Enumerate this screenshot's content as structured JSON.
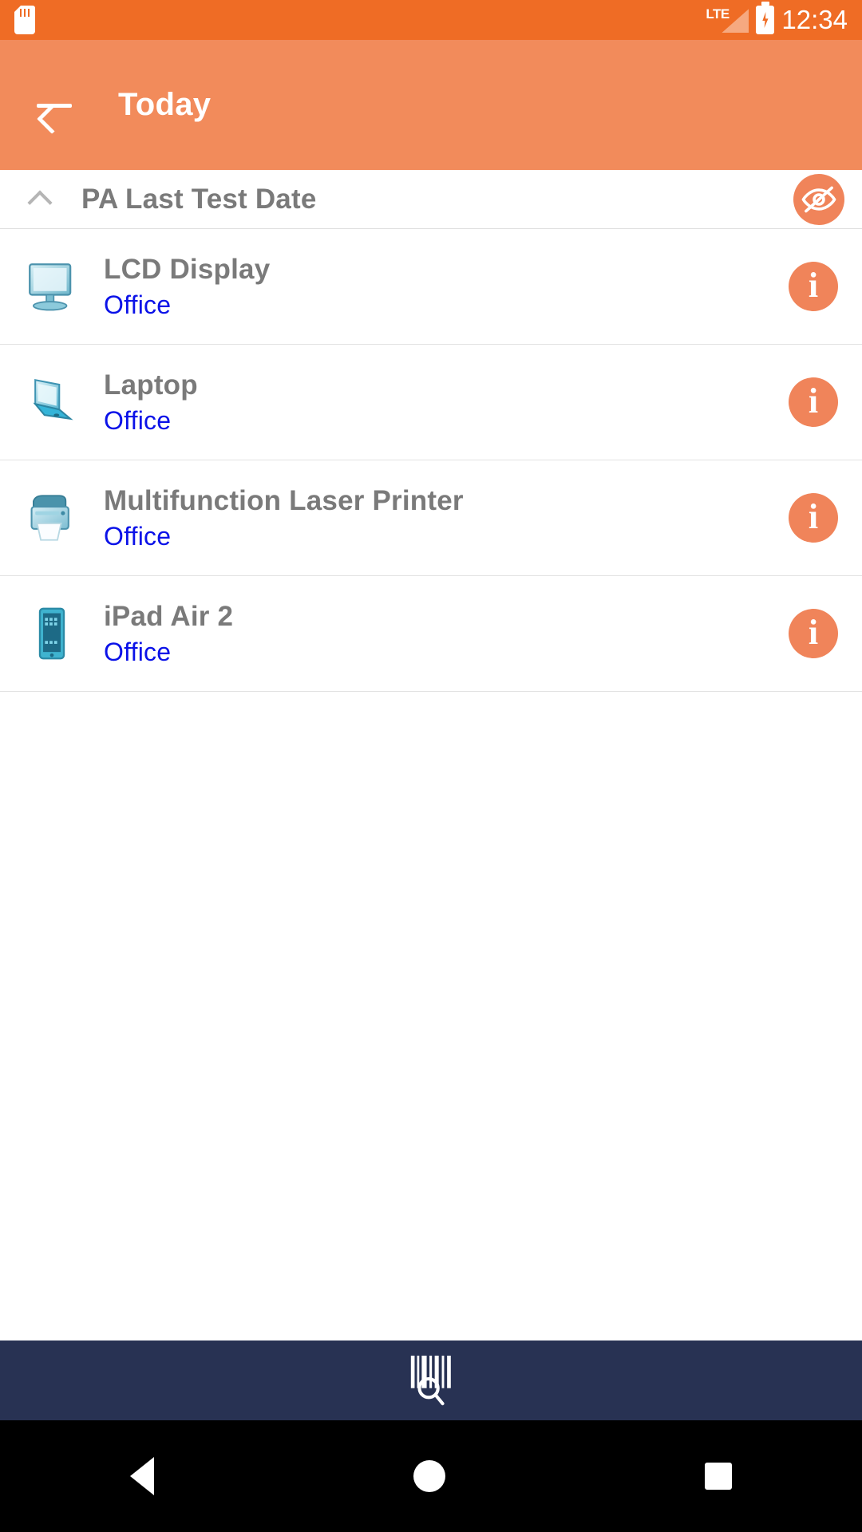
{
  "status_bar": {
    "sd_icon": "sd-card-icon",
    "network_label": "LTE",
    "battery_icon": "battery-charging-icon",
    "time": "12:34",
    "background_color": "#EF6C25"
  },
  "toolbar": {
    "back_icon": "arrow-left-icon",
    "title": "Today",
    "background_color": "#F28B5B"
  },
  "section": {
    "collapse_icon": "chevron-up-icon",
    "title": "PA Last Test Date",
    "visibility_icon": "eye-off-icon",
    "accent_color": "#F0845A",
    "title_color": "#7A7A7A"
  },
  "list": {
    "sub_color": "#0B12E8",
    "info_icon": "info-circle-icon",
    "rows": [
      {
        "icon": "monitor-icon",
        "title": "LCD Display",
        "subtitle": "Office"
      },
      {
        "icon": "laptop-icon",
        "title": "Laptop",
        "subtitle": "Office"
      },
      {
        "icon": "printer-icon",
        "title": "Multifunction Laser Printer",
        "subtitle": "Office"
      },
      {
        "icon": "tablet-icon",
        "title": "iPad Air 2",
        "subtitle": "Office"
      }
    ]
  },
  "bottom_bar": {
    "scan_icon": "barcode-scan-icon",
    "background_color": "#283253"
  },
  "nav_bar": {
    "back_icon": "triangle-back-icon",
    "home_icon": "circle-home-icon",
    "recents_icon": "square-recents-icon",
    "background_color": "#000000"
  }
}
